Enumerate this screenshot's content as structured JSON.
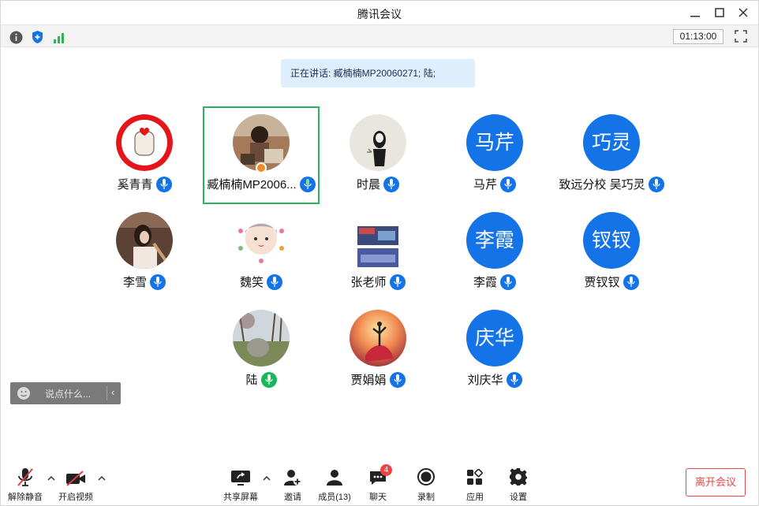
{
  "window": {
    "title": "腾讯会议"
  },
  "status": {
    "timer": "01:13:00"
  },
  "speaking": {
    "text": "正在讲话: 臧楠楠MP20060271; 陆;"
  },
  "participants": [
    {
      "name": "奚青青",
      "avatar_text": "",
      "mic": "blue"
    },
    {
      "name": "臧楠楠MP2006...",
      "avatar_text": "",
      "mic": "green",
      "active": true,
      "host": true
    },
    {
      "name": "时晨",
      "avatar_text": "",
      "mic": "blue"
    },
    {
      "name": "马芹",
      "avatar_text": "马芹",
      "mic": "blue"
    },
    {
      "name": "致远分校 吴巧灵",
      "avatar_text": "巧灵",
      "mic": "blue"
    },
    {
      "name": "李雪",
      "avatar_text": "",
      "mic": "blue"
    },
    {
      "name": "魏笑",
      "avatar_text": "",
      "mic": "blue"
    },
    {
      "name": "张老师",
      "avatar_text": "",
      "mic": "blue"
    },
    {
      "name": "李霞",
      "avatar_text": "李霞",
      "mic": "blue"
    },
    {
      "name": "贾钗钗",
      "avatar_text": "钗钗",
      "mic": "blue"
    },
    {
      "name": "陆",
      "avatar_text": "",
      "mic": "green"
    },
    {
      "name": "贾娟娟",
      "avatar_text": "",
      "mic": "blue"
    },
    {
      "name": "刘庆华",
      "avatar_text": "庆华",
      "mic": "blue"
    }
  ],
  "chat": {
    "placeholder": "说点什么..."
  },
  "toolbar": {
    "unmute": "解除静音",
    "video": "开启视频",
    "share": "共享屏幕",
    "invite": "邀请",
    "members": "成员(13)",
    "chat": "聊天",
    "chat_badge": "4",
    "record": "录制",
    "apps": "应用",
    "settings": "设置",
    "leave": "离开会议"
  },
  "colors": {
    "accent": "#1473e6",
    "active_border": "#27b35b",
    "leave": "#e34b4b"
  }
}
